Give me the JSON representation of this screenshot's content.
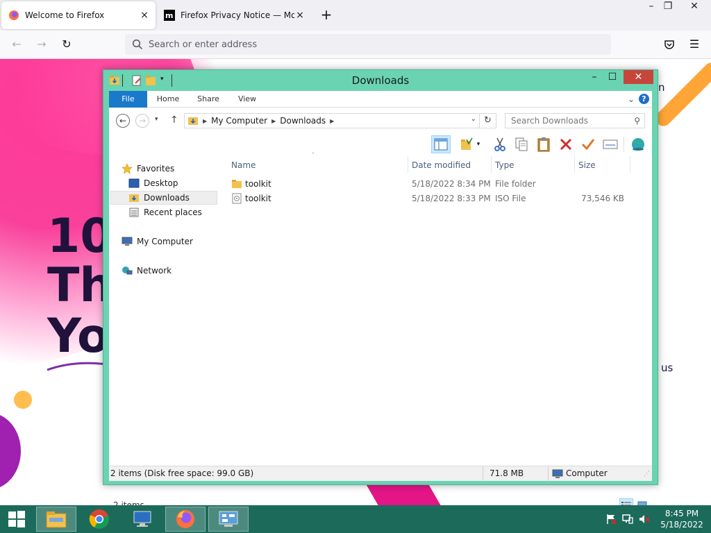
{
  "firefox": {
    "tabs": [
      {
        "title": "Welcome to Firefox",
        "active": true
      },
      {
        "title": "Firefox Privacy Notice — Mozilla",
        "active": false
      }
    ],
    "new_tab": "+",
    "close_glyph": "×",
    "url_placeholder": "Search or enter address"
  },
  "page": {
    "hero_lines": [
      "10",
      "Th",
      "Yo"
    ],
    "side_text_1": "n",
    "side_text_2": "us"
  },
  "explorer": {
    "title": "Downloads",
    "ribbon_tabs": [
      "File",
      "Home",
      "Share",
      "View"
    ],
    "help_label": "?",
    "breadcrumbs": [
      "My Computer",
      "Downloads"
    ],
    "search_placeholder": "Search Downloads",
    "nav": {
      "favorites": "Favorites",
      "desktop": "Desktop",
      "downloads": "Downloads",
      "recent": "Recent places",
      "computer": "My Computer",
      "network": "Network"
    },
    "columns": {
      "name": "Name",
      "date": "Date modified",
      "type": "Type",
      "size": "Size"
    },
    "files": [
      {
        "name": "toolkit",
        "date": "5/18/2022 8:34 PM",
        "type": "File folder",
        "size": ""
      },
      {
        "name": "toolkit",
        "date": "5/18/2022 8:33 PM",
        "type": "ISO File",
        "size": "73,546 KB"
      }
    ],
    "item_count": "2 items",
    "status": {
      "left": "2 items (Disk free space: 99.0 GB)",
      "size": "71.8 MB",
      "location": "Computer"
    }
  },
  "taskbar": {
    "time": "8:45 PM",
    "date": "5/18/2022"
  },
  "colors": {
    "explorer_frame": "#6ad3b2",
    "file_tab": "#1979ca",
    "close_button": "#c7463b",
    "taskbar": "#1c6a5a",
    "hero_text": "#20123a"
  }
}
